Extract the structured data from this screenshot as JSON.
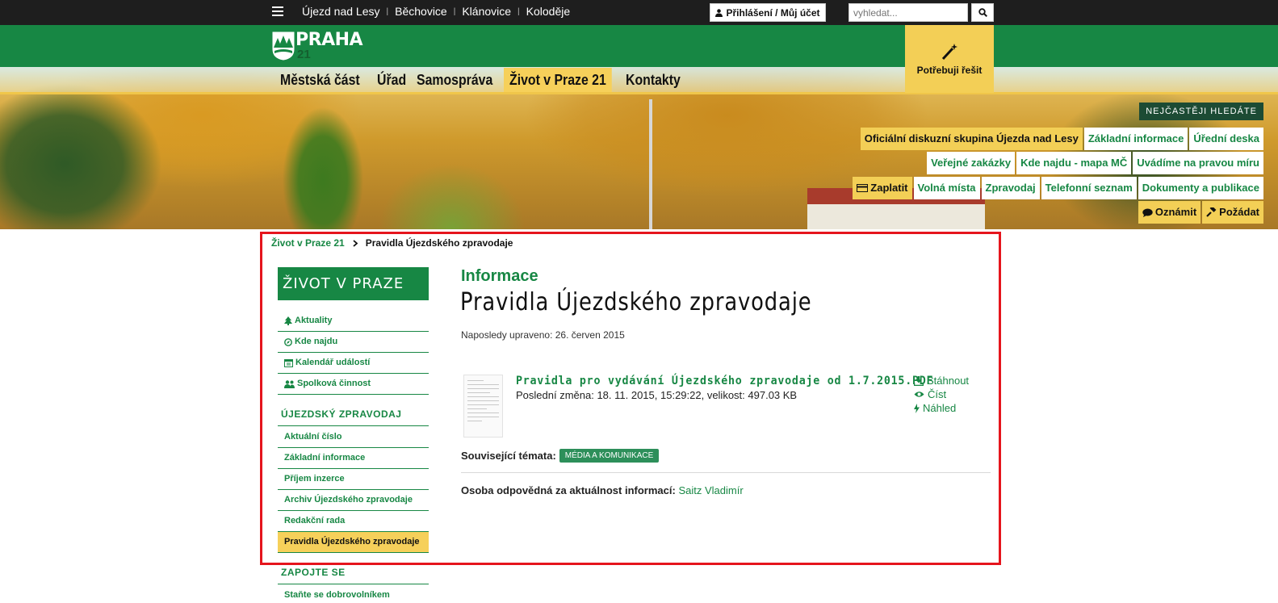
{
  "topbar": {
    "links": [
      "Újezd nad Lesy",
      "Běchovice",
      "Klánovice",
      "Koloděje"
    ],
    "login_label": "Přihlášení / Můj účet",
    "search_placeholder": "vyhledat..."
  },
  "logo": {
    "text": "PRAHA",
    "number": "21"
  },
  "main_nav": [
    "Městská část",
    "Úřad",
    "Samospráva",
    "Život v Praze 21",
    "Kontakty"
  ],
  "help_box": {
    "label": "Potřebuji řešit"
  },
  "frequent": {
    "title": "NEJČASTĚJI HLEDÁTE",
    "row1": [
      "Oficiální diskuzní skupina Újezda nad Lesy",
      "Základní informace",
      "Úřední deska"
    ],
    "row2": [
      "Veřejné zakázky",
      "Kde najdu - mapa MČ",
      "Uvádíme na pravou míru"
    ],
    "row3": [
      "Zaplatit",
      "Volná místa",
      "Zpravodaj",
      "Telefonní seznam",
      "Dokumenty a publikace"
    ],
    "row4": [
      "Oznámit",
      "Požádat"
    ]
  },
  "breadcrumb": {
    "parent": "Život v Praze 21",
    "current": "Pravidla Újezdského zpravodaje"
  },
  "sidebar": {
    "title": "ŽIVOT V PRAZE 21",
    "items": [
      "Aktuality",
      "Kde najdu",
      "Kalendář událostí",
      "Spolková činnost"
    ],
    "section1": "ÚJEZDSKÝ ZPRAVODAJ",
    "section1_items": [
      "Aktuální číslo",
      "Základní informace",
      "Příjem inzerce",
      "Archiv Újezdského zpravodaje",
      "Redakční rada",
      "Pravidla Újezdského zpravodaje"
    ],
    "section2": "ZAPOJTE SE",
    "section2_items": [
      "Staňte se dobrovolníkem"
    ]
  },
  "main": {
    "category": "Informace",
    "title": "Pravidla Újezdského zpravodaje",
    "updated": "Naposledy upraveno: 26. červen 2015",
    "document": {
      "name": "Pravidla pro vydávání Újezdského zpravodaje od 1.7.2015.PDF",
      "meta": "Poslední změna: 18. 11. 2015, 15:29:22, velikost: 497.03 KB",
      "actions": [
        "Stáhnout",
        "Číst",
        "Náhled"
      ]
    },
    "related_label": "Související témata:",
    "related_tag": "MÉDIA A KOMUNIKACE",
    "responsible_label": "Osoba odpovědná za aktuálnost informací:",
    "responsible_name": "Saitz Vladimír"
  },
  "colors": {
    "brand_green": "#178744",
    "accent_yellow": "#f3cf56",
    "frame_red": "#e5151d"
  }
}
